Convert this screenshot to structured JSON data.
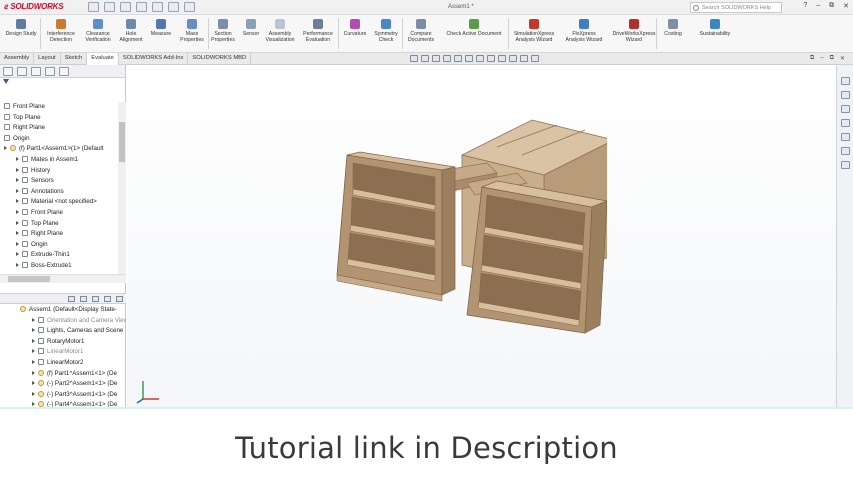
{
  "title_bar": {
    "app_name": "SOLIDWORKS",
    "document_title": "Assem1 *",
    "search_placeholder": "Search SOLIDWORKS Help",
    "window_controls": [
      "?",
      "–",
      "⧉",
      "✕"
    ]
  },
  "ribbon": {
    "buttons": [
      {
        "label1": "Design Study",
        "label2": "",
        "icon": "design-study-icon",
        "color": "#5f7aa0"
      },
      {
        "label1": "Interference",
        "label2": "Detection",
        "icon": "interference-detection-icon",
        "color": "#c97a2e"
      },
      {
        "label1": "Clearance",
        "label2": "Verification",
        "icon": "clearance-verification-icon",
        "color": "#5a8fc9"
      },
      {
        "label1": "Hole",
        "label2": "Alignment",
        "icon": "hole-alignment-icon",
        "color": "#6f89a8"
      },
      {
        "label1": "Measure",
        "label2": "",
        "icon": "measure-icon",
        "color": "#4f79b3"
      },
      {
        "label1": "Mass",
        "label2": "Properties",
        "icon": "mass-properties-icon",
        "color": "#6a8dc0"
      },
      {
        "label1": "Section",
        "label2": "Properties",
        "icon": "section-properties-icon",
        "color": "#7b8fa8"
      },
      {
        "label1": "Sensor",
        "label2": "",
        "icon": "sensor-icon",
        "color": "#8a9fb8"
      },
      {
        "label1": "Assembly",
        "label2": "Visualization",
        "icon": "assembly-visualization-icon",
        "color": "#b9c4d1"
      },
      {
        "label1": "Performance",
        "label2": "Evaluation",
        "icon": "performance-evaluation-icon",
        "color": "#6c7f95"
      },
      {
        "label1": "Curvature",
        "label2": "",
        "icon": "curvature-icon",
        "color": "#b04fb0"
      },
      {
        "label1": "Symmetry",
        "label2": "Check",
        "icon": "symmetry-check-icon",
        "color": "#4d86c8"
      },
      {
        "label1": "Compare",
        "label2": "Documents",
        "icon": "compare-documents-icon",
        "color": "#7b8ea5"
      },
      {
        "label1": "Check Active Document",
        "label2": "",
        "icon": "check-active-document-icon",
        "color": "#5a9a4a"
      },
      {
        "label1": "SimulationXpress",
        "label2": "Analysis Wizard",
        "icon": "simulationxpress-icon",
        "color": "#c0392b"
      },
      {
        "label1": "FloXpress",
        "label2": "Analysis Wizard",
        "icon": "floxpress-icon",
        "color": "#3f7fc0"
      },
      {
        "label1": "DriveWorksXpress",
        "label2": "Wizard",
        "icon": "driveworksxpress-icon",
        "color": "#b03030"
      },
      {
        "label1": "Costing",
        "label2": "",
        "icon": "costing-icon",
        "color": "#7f8fa3"
      },
      {
        "label1": "Sustainability",
        "label2": "",
        "icon": "sustainability-icon",
        "color": "#3b86c6"
      }
    ]
  },
  "command_tabs": [
    "Assembly",
    "Layout",
    "Sketch",
    "Evaluate",
    "SOLIDWORKS Add-Ins",
    "SOLIDWORKS MBD"
  ],
  "active_tab": "Evaluate",
  "feature_tree": {
    "items": [
      {
        "label": "Front Plane",
        "indent": 0,
        "icon": "plane-icon"
      },
      {
        "label": "Top Plane",
        "indent": 0,
        "icon": "plane-icon"
      },
      {
        "label": "Right Plane",
        "indent": 0,
        "icon": "plane-icon"
      },
      {
        "label": "Origin",
        "indent": 0,
        "icon": "origin-icon"
      },
      {
        "label": "(f) Part1<Assem1>(1> (Default",
        "indent": 0,
        "icon": "part-icon"
      },
      {
        "label": "Mates in Assem1",
        "indent": 1,
        "icon": "mates-icon"
      },
      {
        "label": "History",
        "indent": 1,
        "icon": "history-icon"
      },
      {
        "label": "Sensors",
        "indent": 1,
        "icon": "sensors-icon"
      },
      {
        "label": "Annotations",
        "indent": 1,
        "icon": "annotations-icon"
      },
      {
        "label": "Material <not specified>",
        "indent": 1,
        "icon": "material-icon"
      },
      {
        "label": "Front Plane",
        "indent": 1,
        "icon": "plane-icon"
      },
      {
        "label": "Top Plane",
        "indent": 1,
        "icon": "plane-icon"
      },
      {
        "label": "Right Plane",
        "indent": 1,
        "icon": "plane-icon"
      },
      {
        "label": "Origin",
        "indent": 1,
        "icon": "origin-icon"
      },
      {
        "label": "Extrude-Thin1",
        "indent": 1,
        "icon": "extrude-icon"
      },
      {
        "label": "Boss-Extrude1",
        "indent": 1,
        "icon": "extrude-icon"
      }
    ]
  },
  "motion_tree": {
    "items": [
      {
        "label": "Assem1 (Default<Display State-",
        "indent": 0,
        "icon": "assembly-icon",
        "dim": false
      },
      {
        "label": "Orientation and Camera Views",
        "indent": 1,
        "icon": "camera-icon",
        "dim": true
      },
      {
        "label": "Lights, Cameras and Scene",
        "indent": 1,
        "icon": "lights-icon",
        "dim": false
      },
      {
        "label": "RotaryMotor1",
        "indent": 1,
        "icon": "rotary-motor-icon",
        "dim": false
      },
      {
        "label": "LinearMotor1",
        "indent": 1,
        "icon": "linear-motor-icon",
        "dim": true
      },
      {
        "label": "LinearMotor2",
        "indent": 1,
        "icon": "linear-motor-icon",
        "dim": false
      },
      {
        "label": "(f) Part1^Assem1<1> (De",
        "indent": 1,
        "icon": "part-icon",
        "dim": false
      },
      {
        "label": "(-) Part2^Assem1<1> (De",
        "indent": 1,
        "icon": "part-icon",
        "dim": false
      },
      {
        "label": "(-) Part3^Assem1<1> (De",
        "indent": 1,
        "icon": "part-icon",
        "dim": false
      },
      {
        "label": "(-) Part4^Assem1<1> (De",
        "indent": 1,
        "icon": "part-icon",
        "dim": false
      }
    ]
  },
  "caption": "Tutorial link in Description",
  "colors": {
    "wood": "#c4a885",
    "wood_dark": "#8f7455",
    "wood_light": "#d9c3a4",
    "brand_red": "#c8102e"
  }
}
